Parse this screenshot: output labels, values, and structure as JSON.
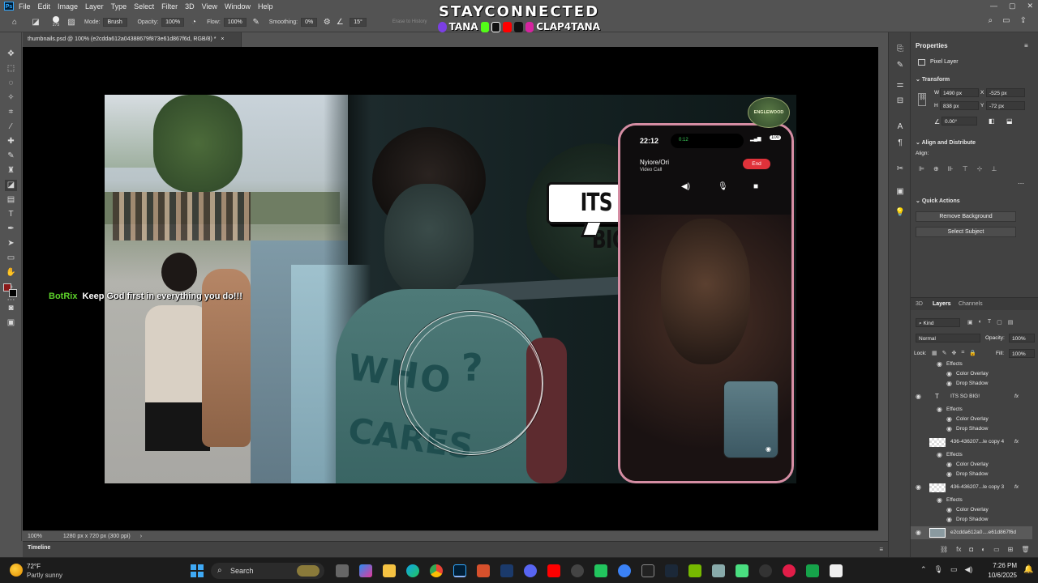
{
  "menu": {
    "items": [
      "File",
      "Edit",
      "Image",
      "Layer",
      "Type",
      "Select",
      "Filter",
      "3D",
      "View",
      "Window",
      "Help"
    ]
  },
  "options": {
    "brush_size": "275",
    "mode_label": "Mode:",
    "mode_value": "Brush",
    "opacity_label": "Opacity:",
    "opacity_value": "100%",
    "flow_label": "Flow:",
    "flow_value": "100%",
    "smoothing_label": "Smoothing:",
    "smoothing_value": "0%",
    "angle_value": "15°",
    "erase_history": "Erase to History"
  },
  "stream_overlay": {
    "title": "STAYCONNECTED",
    "name_left": "TANA",
    "name_right": "CLAP4TANA"
  },
  "document": {
    "tab_title": "thumbnails.psd @ 100% (e2cdda612a04388679f873e61d867f6d, RGB/8) *"
  },
  "canvas": {
    "chat_user": "BotRix",
    "chat_message": "Keep God first in everything you do!!!",
    "speech_text": "ITS SO BIG!",
    "shirt_text_1": "WHO",
    "shirt_text_2": "CARES",
    "phone_time": "22:12",
    "call_timer": "0:12",
    "battery": "100",
    "caller_name": "Nyiore/Ori",
    "call_type": "Video Call",
    "end_label": "End",
    "badge_text": "ENGLEWOOD"
  },
  "status": {
    "zoom": "100%",
    "doc_size": "1280 px x 720 px (300 ppi)"
  },
  "timeline": {
    "label": "Timeline"
  },
  "properties": {
    "title": "Properties",
    "kind": "Pixel Layer",
    "transform_label": "Transform",
    "w_label": "W",
    "w_value": "1490 px",
    "h_label": "H",
    "h_value": "838 px",
    "x_label": "X",
    "x_value": "-525 px",
    "y_label": "Y",
    "y_value": "-72 px",
    "angle_value": "0.00°",
    "align_label": "Align and Distribute",
    "align_sub": "Align:",
    "quick_actions_label": "Quick Actions",
    "remove_bg": "Remove Background",
    "select_subject": "Select Subject"
  },
  "layers_panel": {
    "tabs": [
      "3D",
      "Layers",
      "Channels"
    ],
    "kind_filter": "Kind",
    "blend_mode": "Normal",
    "opacity_label": "Opacity:",
    "opacity_value": "100%",
    "lock_label": "Lock:",
    "fill_label": "Fill:",
    "fill_value": "100%",
    "rows": [
      {
        "text": "Effects",
        "type": "sub"
      },
      {
        "text": "Color Overlay",
        "type": "effect"
      },
      {
        "text": "Drop Shadow",
        "type": "effect"
      },
      {
        "text": "ITS SO BIG!",
        "type": "text-layer"
      },
      {
        "text": "Effects",
        "type": "sub"
      },
      {
        "text": "Color Overlay",
        "type": "effect"
      },
      {
        "text": "Drop Shadow",
        "type": "effect"
      },
      {
        "text": "436-436207...le copy 4",
        "type": "image-layer"
      },
      {
        "text": "Effects",
        "type": "sub"
      },
      {
        "text": "Color Overlay",
        "type": "effect"
      },
      {
        "text": "Drop Shadow",
        "type": "effect"
      },
      {
        "text": "436-436207...le copy 3",
        "type": "image-layer"
      },
      {
        "text": "Effects",
        "type": "sub"
      },
      {
        "text": "Color Overlay",
        "type": "effect"
      },
      {
        "text": "Drop Shadow",
        "type": "effect"
      },
      {
        "text": "e2cdda612a0....e61d867f6d",
        "type": "image-layer"
      }
    ]
  },
  "taskbar": {
    "temperature": "72°F",
    "weather": "Partly sunny",
    "search_label": "Search",
    "time": "7:26 PM",
    "date": "10/6/2025"
  },
  "colors": {
    "foreground": "#8b1a1a",
    "end_button": "#e0323a",
    "chat_user": "#5dd12a"
  }
}
